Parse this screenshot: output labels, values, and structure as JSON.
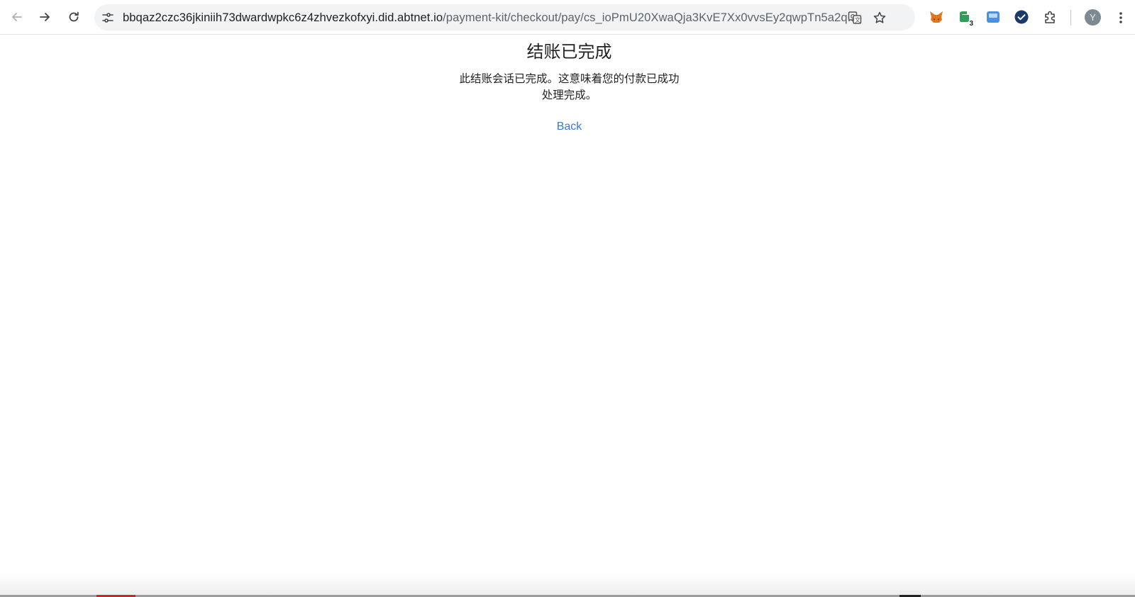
{
  "browser": {
    "url_host": "bbqaz2czc36jkiniih73dwardwpkc6z4zhvezkofxyi.did.abtnet.io",
    "url_path": "/payment-kit/checkout/pay/cs_ioPmU20XwaQja3KvE7Xx0vvsEy2qwpTn5a2q...",
    "extensions": [
      {
        "name": "fox-extension",
        "color": "#e2761b"
      },
      {
        "name": "green-extension",
        "color": "#2e9e5b",
        "badge": "3"
      },
      {
        "name": "card-extension",
        "color": "#4a90e2"
      },
      {
        "name": "check-extension",
        "color": "#1a3a6b"
      }
    ],
    "avatar_letter": "Y"
  },
  "page": {
    "title": "结账已完成",
    "description": "此结账会话已完成。这意味着您的付款已成功处理完成。",
    "back_label": "Back"
  },
  "colors": {
    "link": "#3a78d4",
    "omnibox": "#f1f3f4"
  }
}
